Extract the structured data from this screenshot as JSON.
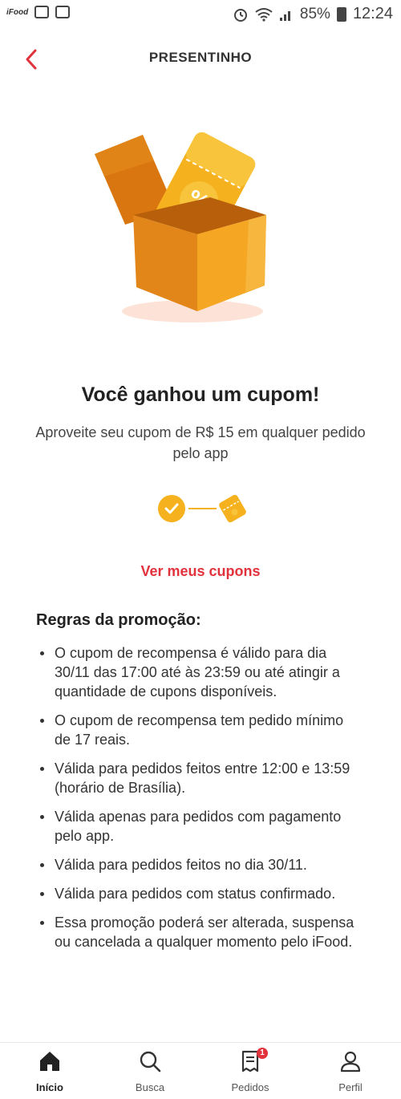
{
  "status_bar": {
    "left_brand": "iFood",
    "battery": "85%",
    "time": "12:24"
  },
  "header": {
    "title": "PRESENTINHO"
  },
  "hero": {
    "coupon_symbol": "%"
  },
  "main": {
    "title": "Você ganhou um cupom!",
    "subtitle": "Aproveite seu cupom de R$ 15 em qualquer pedido pelo app",
    "link": "Ver meus cupons"
  },
  "progress": {
    "step1_icon": "check-icon",
    "step2_icon": "coupon-icon",
    "colors": {
      "accent": "#f5b21e"
    }
  },
  "rules": {
    "title": "Regras da promoção:",
    "items": [
      "O cupom de recompensa é válido para dia 30/11 das 17:00 até às 23:59 ou até atingir a quantidade de cupons disponíveis.",
      "O cupom de recompensa tem pedido mínimo de 17 reais.",
      "Válida para pedidos feitos entre 12:00 e 13:59 (horário de Brasília).",
      "Válida apenas para pedidos com pagamento pelo app.",
      "Válida para pedidos feitos no dia 30/11.",
      "Válida para pedidos com status confirmado.",
      "Essa promoção poderá ser alterada, suspensa ou cancelada a qualquer momento pelo iFood."
    ]
  },
  "bottom_nav": {
    "items": [
      {
        "label": "Início",
        "icon": "home-icon"
      },
      {
        "label": "Busca",
        "icon": "search-icon"
      },
      {
        "label": "Pedidos",
        "icon": "orders-icon",
        "badge": "1"
      },
      {
        "label": "Perfil",
        "icon": "profile-icon"
      }
    ]
  },
  "colors": {
    "brand_red": "#e2323c",
    "box_orange": "#f29a1e",
    "box_dark": "#d9760f"
  }
}
